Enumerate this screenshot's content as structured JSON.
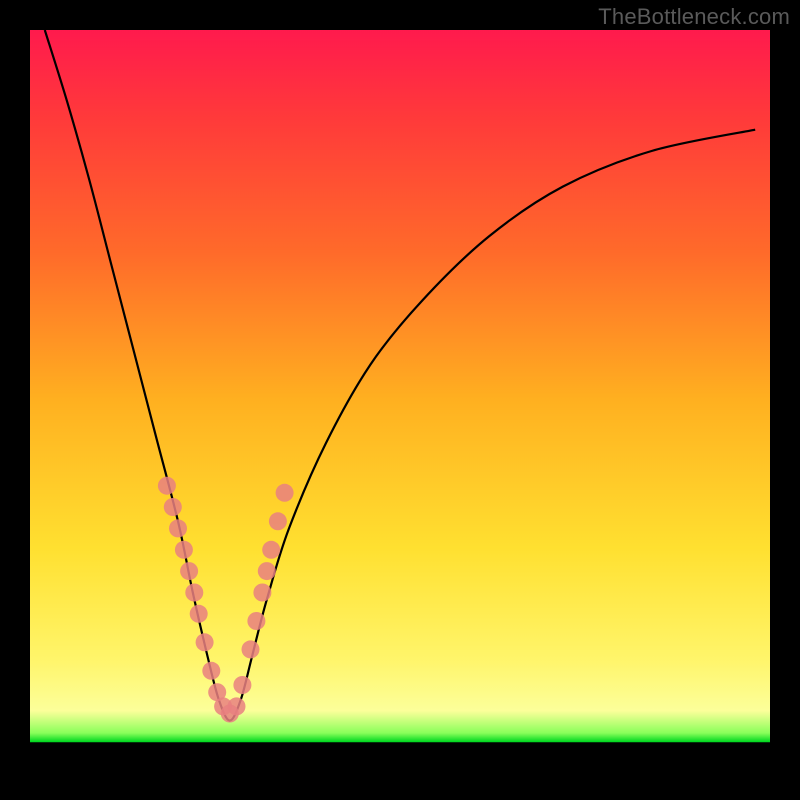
{
  "watermark": "TheBottleneck.com",
  "chart_data": {
    "type": "line",
    "title": "",
    "xlabel": "",
    "ylabel": "",
    "xlim": [
      0,
      100
    ],
    "ylim": [
      0,
      100
    ],
    "grid": false,
    "legend": false,
    "notes": "V-shaped bottleneck curve. Axes have no tick labels; values are estimated in percent of plot width/height. Minimum (optimal match) at roughly x≈27. Left branch is steep, right branch shallower. Pink marker dots cluster near the bottom of the V on both branches.",
    "series": [
      {
        "name": "bottleneck-curve",
        "color": "#000000",
        "x": [
          2,
          5,
          8,
          11,
          14,
          17,
          20,
          22,
          24,
          25.5,
          27,
          28.5,
          30,
          32,
          35,
          40,
          46,
          53,
          62,
          72,
          84,
          98
        ],
        "y": [
          100,
          90,
          79,
          67,
          55,
          43,
          31,
          21,
          12,
          6,
          3,
          6,
          12,
          20,
          30,
          42,
          53,
          62,
          71,
          78,
          83,
          86
        ]
      },
      {
        "name": "marker-dots",
        "type": "scatter",
        "color": "#e98080",
        "x": [
          18.5,
          19.3,
          20.0,
          20.8,
          21.5,
          22.2,
          22.8,
          23.6,
          24.5,
          25.3,
          26.1,
          27.0,
          27.9,
          28.7,
          29.8,
          30.6,
          31.4,
          32.0,
          32.6,
          33.5,
          34.4
        ],
        "y": [
          36,
          33,
          30,
          27,
          24,
          21,
          18,
          14,
          10,
          7,
          5,
          4,
          5,
          8,
          13,
          17,
          21,
          24,
          27,
          31,
          35
        ]
      }
    ]
  }
}
